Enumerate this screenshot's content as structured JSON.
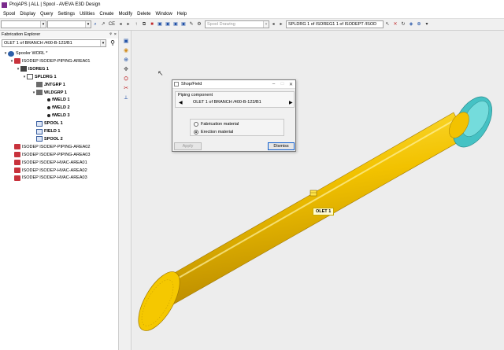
{
  "window": {
    "title": "ProjAPS | ALL | Spool - AVEVA E3D Design"
  },
  "menu": [
    "Spool",
    "Display",
    "Query",
    "Settings",
    "Utilities",
    "Create",
    "Modify",
    "Delete",
    "Window",
    "Help"
  ],
  "toolbar": {
    "combo_1": "",
    "combo_2": "",
    "ce_label": "CE",
    "drawing_placeholder": "Spool Drawing",
    "current_element": "SPLDRG 1 of ISOREG1 1 of ISODEPT /ISOD"
  },
  "explorer": {
    "title": "Fabrication Explorer",
    "pin": "ᵠ",
    "close": "×",
    "selector_value": "OLET 1 of BRANCH /400-B-123/B1",
    "tree": [
      {
        "label": "Spooler WORL *",
        "icon": "globe",
        "bold": false
      },
      {
        "label": "ISODEP ISODEP-PIPING-AREA01",
        "icon": "db",
        "bold": false
      },
      {
        "label": "ISOREG 1",
        "icon": "reg",
        "bold": true
      },
      {
        "label": "SPLDRG 1",
        "icon": "drw",
        "bold": true
      },
      {
        "label": "JNTGRP 1",
        "icon": "grp",
        "bold": true
      },
      {
        "label": "WLDGRP 1",
        "icon": "grp",
        "bold": true
      },
      {
        "label": "fWELD 1",
        "icon": "weld",
        "bold": true
      },
      {
        "label": "fWELD 2",
        "icon": "weld",
        "bold": true
      },
      {
        "label": "fWELD 3",
        "icon": "weld",
        "bold": true
      },
      {
        "label": "SPOOL 1",
        "icon": "spool",
        "bold": true
      },
      {
        "label": "FIELD 1",
        "icon": "field",
        "bold": true
      },
      {
        "label": "SPOOL 2",
        "icon": "spool",
        "bold": true
      },
      {
        "label": "ISODEP ISODEP-PIPING-AREA02",
        "icon": "db",
        "bold": false
      },
      {
        "label": "ISODEP ISODEP-PIPING-AREA03",
        "icon": "db",
        "bold": false
      },
      {
        "label": "ISODEP ISODEP-HVAC-AREA01",
        "icon": "db",
        "bold": false
      },
      {
        "label": "ISODEP ISODEP-HVAC-AREA02",
        "icon": "db",
        "bold": false
      },
      {
        "label": "ISODEP ISODEP-HVAC-AREA03",
        "icon": "db",
        "bold": false
      }
    ]
  },
  "dialog": {
    "title": "Shop/Field",
    "group_label": "Piping component",
    "component": "OLET 1 of BRANCH /400-B-123/B1",
    "option_fabrication": "Fabrication material",
    "option_erection": "Erection material",
    "selected_option": "Erection material",
    "apply_label": "Apply",
    "dismiss_label": "Dismiss"
  },
  "viewport": {
    "olet_label": "OLET 1"
  },
  "colors": {
    "pipe": "#f2c200",
    "pipe_highlight": "#ffe44a",
    "pipe_shadow": "#c99a00",
    "flange": "#45c2c4"
  }
}
